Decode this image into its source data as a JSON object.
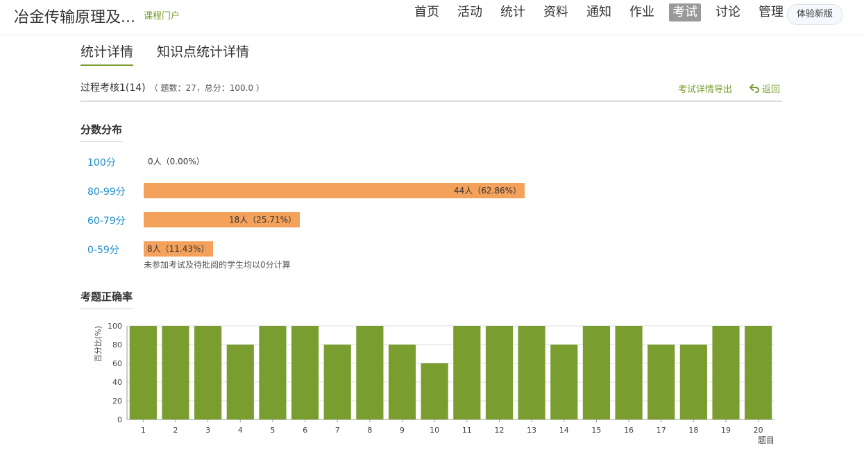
{
  "header": {
    "course_title": "冶金传输原理及...",
    "course_portal": "课程门户",
    "nav": [
      {
        "label": "首页"
      },
      {
        "label": "活动"
      },
      {
        "label": "统计"
      },
      {
        "label": "资料"
      },
      {
        "label": "通知"
      },
      {
        "label": "作业"
      },
      {
        "label": "考试",
        "active": true
      },
      {
        "label": "讨论"
      },
      {
        "label": "管理"
      }
    ],
    "new_version": "体验新版"
  },
  "tabs": {
    "stats_detail": "统计详情",
    "knowledge_detail": "知识点统计详情"
  },
  "exam": {
    "name": "过程考核1(14)",
    "meta": "（ 题数：27，总分：100.0 ）",
    "export": "考试详情导出",
    "back": "返回"
  },
  "score_distribution": {
    "title": "分数分布",
    "items": [
      {
        "label": "100分",
        "text": "0人（0.00%）",
        "percent": 0.0
      },
      {
        "label": "80-99分",
        "text": "44人（62.86%）",
        "percent": 62.86
      },
      {
        "label": "60-79分",
        "text": "18人（25.71%）",
        "percent": 25.71
      },
      {
        "label": "0-59分",
        "text": "8人（11.43%）",
        "percent": 11.43
      }
    ],
    "note": "未参加考试及待批阅的学生均以0分计算"
  },
  "accuracy": {
    "title": "考题正确率"
  },
  "colors": {
    "accent": "#7a9d2f",
    "bar_orange": "#f4a15c",
    "bar_green": "#7a9d2f",
    "link_blue": "#1c8ccf"
  },
  "chart_data": {
    "type": "bar",
    "categories": [
      "1",
      "2",
      "3",
      "4",
      "5",
      "6",
      "7",
      "8",
      "9",
      "10",
      "11",
      "12",
      "13",
      "14",
      "15",
      "16",
      "17",
      "18",
      "19",
      "20"
    ],
    "values": [
      100,
      100,
      100,
      80,
      100,
      100,
      80,
      100,
      80,
      60,
      100,
      100,
      100,
      80,
      100,
      100,
      80,
      80,
      100,
      100
    ],
    "ylabel": "百分比(%)",
    "xlabel": "题目",
    "ylim": [
      0,
      100
    ],
    "yticks": [
      0,
      20,
      40,
      60,
      80,
      100
    ],
    "grid": true
  }
}
